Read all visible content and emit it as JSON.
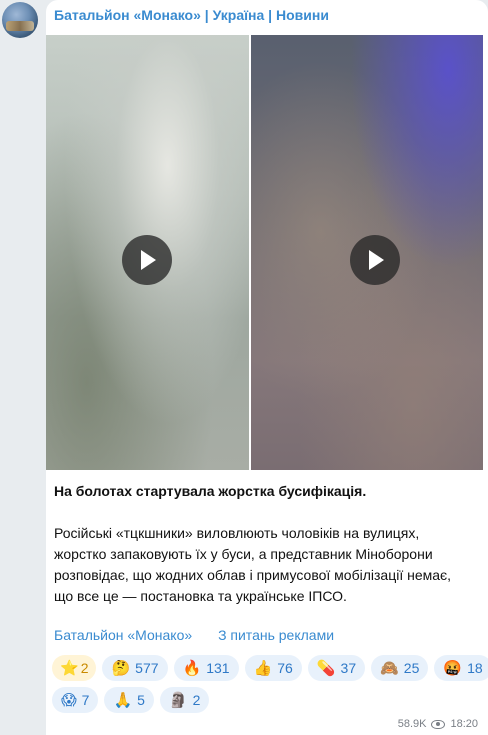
{
  "channel": {
    "name": "Батальйон «Монако» | Україна | Новини"
  },
  "post": {
    "headline": "На болотах стартувала жорстка бусифікація.",
    "body": [
      "Російські «тцкшники» виловлюють чоловіків на вулицях,",
      "жорстко запаковують їх у буси, а представник Міноборони",
      "розповідає, що жодних облав і примусової мобілізації немає,",
      "що все це — постановка та українське ІПСО."
    ],
    "links": {
      "channel": "Батальйон «Монако»",
      "ads": "З питань реклами"
    }
  },
  "reactions": [
    {
      "emoji": "⭐",
      "count": "2",
      "icon": "star-icon"
    },
    {
      "emoji": "🤔",
      "count": "577",
      "icon": "thinking-face-icon"
    },
    {
      "emoji": "🔥",
      "count": "131",
      "icon": "fire-icon"
    },
    {
      "emoji": "👍",
      "count": "76",
      "icon": "thumbs-up-icon"
    },
    {
      "emoji": "💊",
      "count": "37",
      "icon": "pill-icon"
    },
    {
      "emoji": "🙈",
      "count": "25",
      "icon": "see-no-evil-monkey-icon"
    },
    {
      "emoji": "🤬",
      "count": "18",
      "icon": "cursing-face-icon"
    },
    {
      "emoji": "😱",
      "count": "7",
      "icon": "screaming-face-icon"
    },
    {
      "emoji": "🙏",
      "count": "5",
      "icon": "folded-hands-icon"
    },
    {
      "emoji": "🗿",
      "count": "2",
      "icon": "moai-icon"
    }
  ],
  "meta": {
    "views": "58.9K",
    "time": "18:20"
  },
  "colors": {
    "accent": "#3a8bd0",
    "reaction_bg": "#e8f1fb",
    "star_bg": "#fff4d6"
  }
}
